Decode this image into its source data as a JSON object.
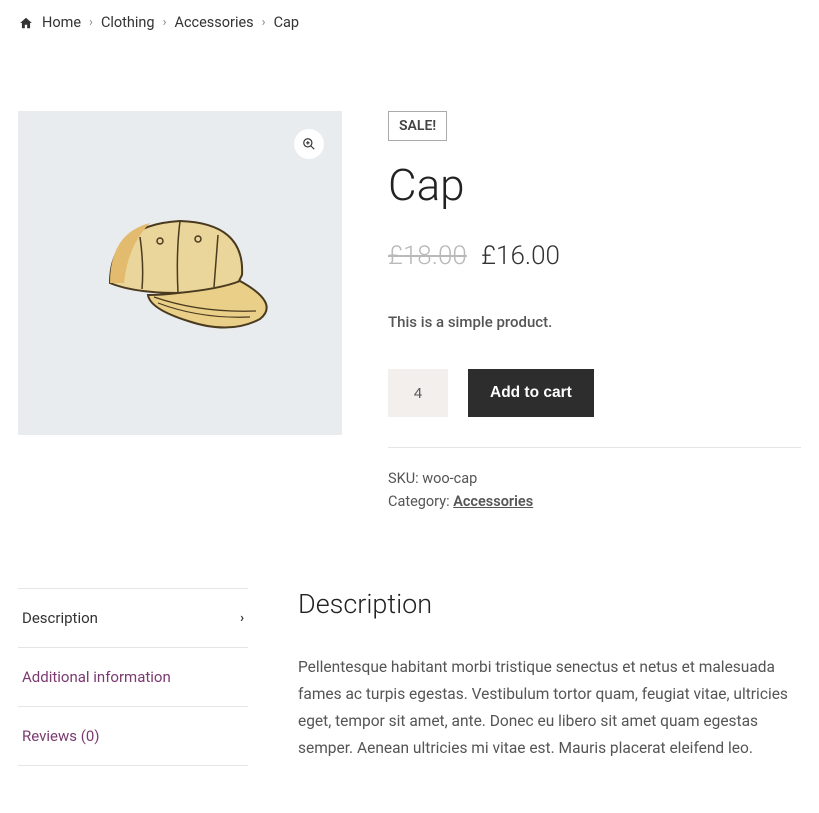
{
  "breadcrumb": {
    "home": "Home",
    "clothing": "Clothing",
    "accessories": "Accessories",
    "current": "Cap"
  },
  "product": {
    "sale_label": "SALE!",
    "title": "Cap",
    "currency": "£",
    "price_old": "18.00",
    "price_new": "16.00",
    "short_desc": "This is a simple product.",
    "qty": "4",
    "add_to_cart": "Add to cart",
    "sku_label": "SKU: ",
    "sku_value": "woo-cap",
    "category_label": "Category: ",
    "category_value": "Accessories"
  },
  "tabs": {
    "description": "Description",
    "additional": "Additional information",
    "reviews": "Reviews (0)"
  },
  "panel": {
    "heading": "Description",
    "body": "Pellentesque habitant morbi tristique senectus et netus et malesuada fames ac turpis egestas. Vestibulum tortor quam, feugiat vitae, ultricies eget, tempor sit amet, ante. Donec eu libero sit amet quam egestas semper. Aenean ultricies mi vitae est. Mauris placerat eleifend leo."
  }
}
